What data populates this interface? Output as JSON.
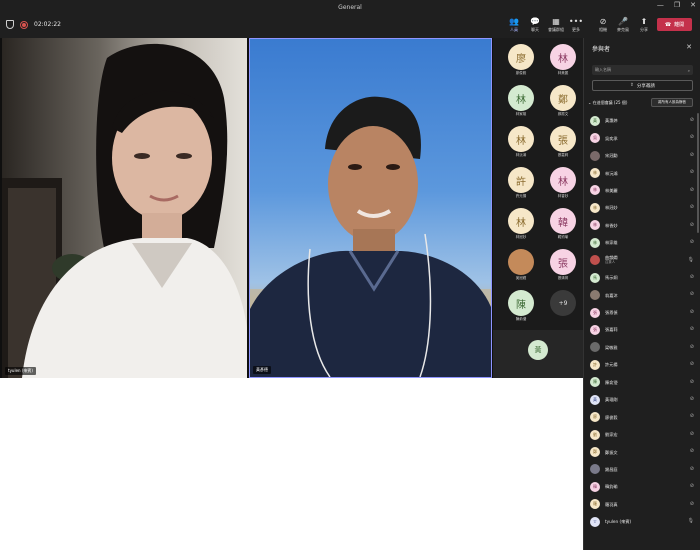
{
  "window": {
    "title": "General",
    "minimize": "—",
    "restore": "❐",
    "close": "✕"
  },
  "toolbar": {
    "timer": "02:02:22",
    "items": [
      {
        "icon": "👥",
        "label": "人員"
      },
      {
        "icon": "💬",
        "label": "聊天"
      },
      {
        "icon": "▦",
        "label": "會議群組"
      },
      {
        "icon": "•••",
        "label": "更多"
      },
      {
        "icon": "⊘",
        "label": "相機"
      },
      {
        "icon": "🎤",
        "label": "麥克風"
      },
      {
        "icon": "⬆",
        "label": "分享"
      }
    ],
    "leave_label": "離開",
    "leave_icon": "☎"
  },
  "stage": {
    "left_name": "tyulen (來賓)",
    "right_name": "黃彥德"
  },
  "gallery": {
    "tiles": [
      {
        "char": "廖",
        "name": "廖俊毅",
        "bg": "#f6e7c8",
        "fg": "#8a6b2e"
      },
      {
        "char": "林",
        "name": "林美麗",
        "bg": "#f7d3e4",
        "fg": "#8b3a62"
      },
      {
        "char": "林",
        "name": "林家雄",
        "bg": "#d4ead0",
        "fg": "#3c6a34"
      },
      {
        "char": "鄭",
        "name": "鄭振文",
        "bg": "#f6e7c8",
        "fg": "#8a6b2e"
      },
      {
        "char": "林",
        "name": "林沅鴻",
        "bg": "#f6e7c8",
        "fg": "#8a6b2e"
      },
      {
        "char": "張",
        "name": "張嘉莉",
        "bg": "#f6e7c8",
        "fg": "#8a6b2e"
      },
      {
        "char": "許",
        "name": "許元揚",
        "bg": "#f6e7c8",
        "fg": "#8a6b2e"
      },
      {
        "char": "林",
        "name": "林香妙",
        "bg": "#f7d3e4",
        "fg": "#8b3a62"
      },
      {
        "char": "林",
        "name": "林冠妙",
        "bg": "#f6e7c8",
        "fg": "#8a6b2e"
      },
      {
        "char": "韓",
        "name": "韓鈞瑜",
        "bg": "#f7d3e4",
        "fg": "#8b3a62"
      },
      {
        "char": "",
        "name": "吳冠緯",
        "bg": "#c48a5a",
        "fg": "#ffffff"
      },
      {
        "char": "張",
        "name": "張清育",
        "bg": "#f7d3e4",
        "fg": "#8b3a62"
      },
      {
        "char": "陳",
        "name": "陳俞瀅",
        "bg": "#d4ead0",
        "fg": "#3c6a34"
      },
      {
        "char": "+9",
        "name": "",
        "bg": "#3a3a3a",
        "fg": "#e0e0e0"
      }
    ],
    "bottom_avatar": {
      "char": "黃",
      "bg": "#d4ead0",
      "fg": "#3c6a34"
    }
  },
  "panel": {
    "title": "參與者",
    "search_placeholder": "輸入名稱",
    "share_label": "分享邀請",
    "section_label": "在這個會議 (25 個)",
    "mute_all_label": "將所有人設為靜音",
    "participants": [
      {
        "char": "黃",
        "name": "黃惠婷",
        "role": "",
        "bg": "#d4ead0",
        "fg": "#3c6a34",
        "mic": "off"
      },
      {
        "char": "吳",
        "name": "吳奕承",
        "role": "",
        "bg": "#f7d3e4",
        "fg": "#8b3a62",
        "mic": "off"
      },
      {
        "char": "",
        "name": "宋冠勳",
        "role": "",
        "bg": "#7a6a6a",
        "fg": "#ffffff",
        "mic": "off"
      },
      {
        "char": "林",
        "name": "林沅鴻",
        "role": "",
        "bg": "#f6e7c8",
        "fg": "#8a6b2e",
        "mic": "off"
      },
      {
        "char": "林",
        "name": "林美麗",
        "role": "",
        "bg": "#f7d3e4",
        "fg": "#8b3a62",
        "mic": "off"
      },
      {
        "char": "林",
        "name": "林冠妙",
        "role": "",
        "bg": "#f6e7c8",
        "fg": "#8a6b2e",
        "mic": "off"
      },
      {
        "char": "林",
        "name": "林香妙",
        "role": "",
        "bg": "#f7d3e4",
        "fg": "#8b3a62",
        "mic": "off"
      },
      {
        "char": "林",
        "name": "林家雄",
        "role": "",
        "bg": "#d4ead0",
        "fg": "#3c6a34",
        "mic": "off"
      },
      {
        "char": "",
        "name": "曲韻嫺",
        "role": "召集人",
        "bg": "#c0504d",
        "fg": "#ffffff",
        "mic": "on"
      },
      {
        "char": "馬",
        "name": "馬示銅",
        "role": "",
        "bg": "#d4ead0",
        "fg": "#3c6a34",
        "mic": "off"
      },
      {
        "char": "",
        "name": "翁嘉沐",
        "role": "",
        "bg": "#8a7a70",
        "fg": "#ffffff",
        "mic": "off"
      },
      {
        "char": "張",
        "name": "張恩偵",
        "role": "",
        "bg": "#f7d3e4",
        "fg": "#8b3a62",
        "mic": "off"
      },
      {
        "char": "張",
        "name": "張嘉莉",
        "role": "",
        "bg": "#f7d3e4",
        "fg": "#8b3a62",
        "mic": "off"
      },
      {
        "char": "",
        "name": "梁敏雅",
        "role": "",
        "bg": "#6a6a6a",
        "fg": "#ffffff",
        "mic": "off"
      },
      {
        "char": "許",
        "name": "許元揚",
        "role": "",
        "bg": "#f6e7c8",
        "fg": "#8a6b2e",
        "mic": "off"
      },
      {
        "char": "陳",
        "name": "陳俞瀅",
        "role": "",
        "bg": "#d4ead0",
        "fg": "#3c6a34",
        "mic": "off"
      },
      {
        "char": "黃",
        "name": "黃琨剛",
        "role": "",
        "bg": "#e0e4f6",
        "fg": "#3a4a8a",
        "mic": "off"
      },
      {
        "char": "廖",
        "name": "廖俊毅",
        "role": "",
        "bg": "#f6e7c8",
        "fg": "#8a6b2e",
        "mic": "off"
      },
      {
        "char": "劉",
        "name": "劉家宏",
        "role": "",
        "bg": "#f6e7c8",
        "fg": "#8a6b2e",
        "mic": "off"
      },
      {
        "char": "鄭",
        "name": "鄭振文",
        "role": "",
        "bg": "#f6e7c8",
        "fg": "#8a6b2e",
        "mic": "off"
      },
      {
        "char": "",
        "name": "謝昌庭",
        "role": "",
        "bg": "#7a7a8a",
        "fg": "#ffffff",
        "mic": "off"
      },
      {
        "char": "韓",
        "name": "韓鈞瑜",
        "role": "",
        "bg": "#f7d3e4",
        "fg": "#8b3a62",
        "mic": "off"
      },
      {
        "char": "羅",
        "name": "羅羽真",
        "role": "",
        "bg": "#f6e7c8",
        "fg": "#8a6b2e",
        "mic": "off"
      },
      {
        "char": "T",
        "name": "tyulen (來賓)",
        "role": "",
        "bg": "#e0e4f6",
        "fg": "#3a4a8a",
        "mic": "on"
      }
    ]
  },
  "colors": {
    "accent": "#8f95ff",
    "leave": "#c4314b",
    "panel_bg": "#1f1f1f"
  }
}
